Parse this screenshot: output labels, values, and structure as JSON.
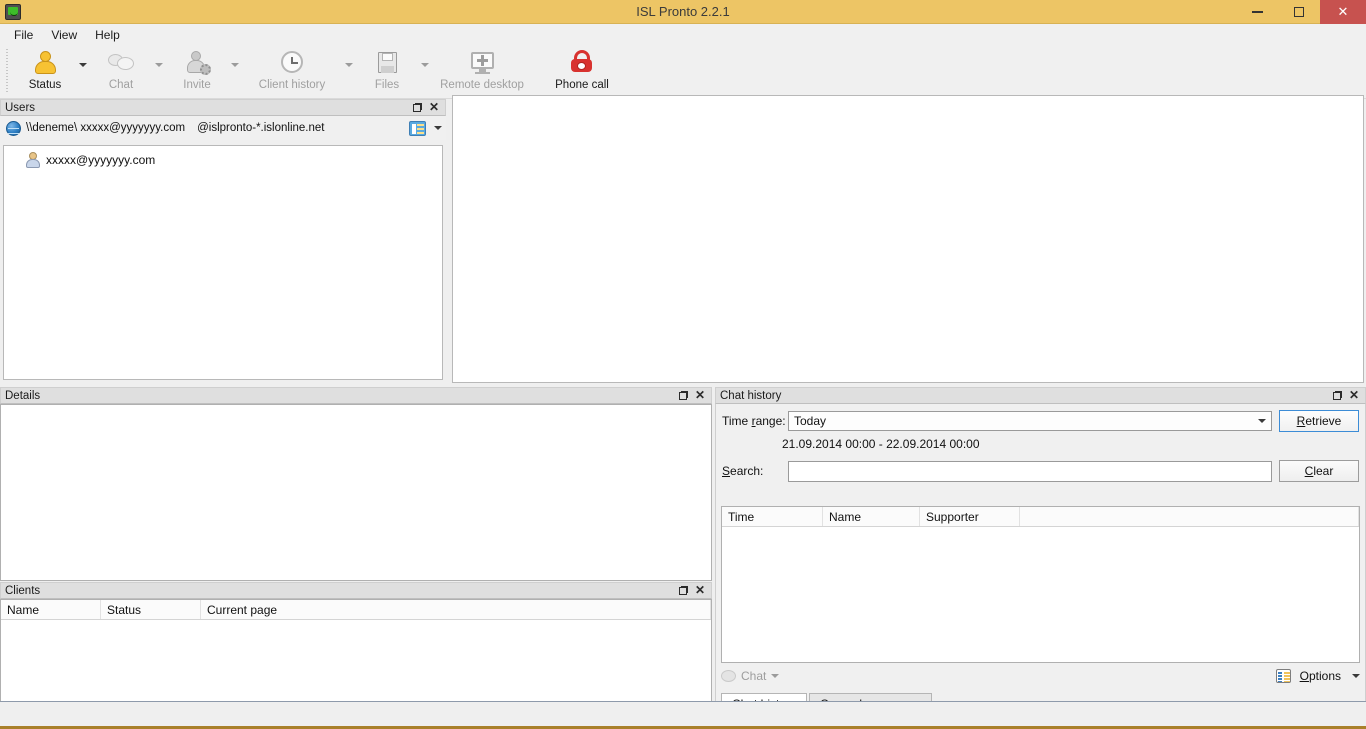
{
  "window": {
    "title": "ISL Pronto 2.2.1",
    "app_icon": "monitor-smiley-icon",
    "titlebar_color": "#edc565",
    "close_color": "#c7524f",
    "minimize_label": "–",
    "maximize_label": "❐",
    "close_label": "✕"
  },
  "menubar": {
    "items": [
      {
        "label": "File"
      },
      {
        "label": "View"
      },
      {
        "label": "Help"
      }
    ]
  },
  "toolbar": {
    "buttons": [
      {
        "label": "Status",
        "icon": "user-status-icon",
        "disabled": false,
        "has_dropdown": true
      },
      {
        "label": "Chat",
        "icon": "chat-bubbles-icon",
        "disabled": true,
        "has_dropdown": true
      },
      {
        "label": "Invite",
        "icon": "invite-user-icon",
        "disabled": true,
        "has_dropdown": true
      },
      {
        "label": "Client history",
        "icon": "clock-icon",
        "disabled": true,
        "has_dropdown": true
      },
      {
        "label": "Files",
        "icon": "floppy-disk-icon",
        "disabled": true,
        "has_dropdown": true
      },
      {
        "label": "Remote desktop",
        "icon": "remote-desktop-icon",
        "disabled": true,
        "has_dropdown": false
      },
      {
        "label": "Phone call",
        "icon": "phone-icon",
        "disabled": false,
        "has_dropdown": false
      }
    ]
  },
  "users_panel": {
    "title": "Users",
    "account": "\\\\deneme\\ xxxxx@yyyyyyy.com",
    "host": "@islpronto-*.islonline.net",
    "view_icon": "listview-icon",
    "tree": [
      {
        "label": "xxxxx@yyyyyyy.com",
        "icon": "person-icon"
      }
    ]
  },
  "details_panel": {
    "title": "Details",
    "content": ""
  },
  "clients_panel": {
    "title": "Clients",
    "columns": [
      "Name",
      "Status",
      "Current page"
    ],
    "rows": []
  },
  "chat_panel": {
    "title": "Chat history",
    "time_range_label": "Time range:",
    "time_range_accel": "r",
    "time_range_value": "Today",
    "retrieve_label": "Retrieve",
    "date_range": "21.09.2014 00:00 - 22.09.2014 00:00",
    "search_label": "Search:",
    "search_value": "",
    "search_placeholder": "",
    "clear_label": "Clear",
    "columns": [
      "Time",
      "Name",
      "Supporter"
    ],
    "rows": [],
    "chat_button_label": "Chat",
    "options_label": "Options",
    "tabs": [
      {
        "label": "Chat history",
        "active": true
      },
      {
        "label": "Canned responses",
        "active": false
      }
    ]
  },
  "panel_buttons": {
    "float_title": "Float",
    "close_title": "Close"
  }
}
